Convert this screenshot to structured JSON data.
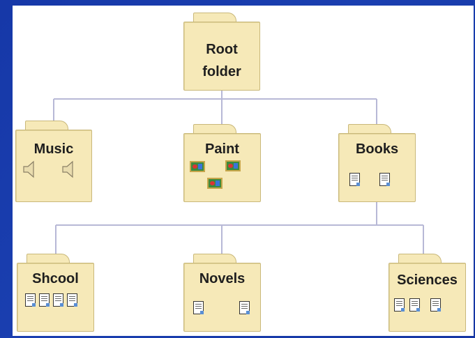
{
  "root": {
    "label_line1": "Root",
    "label_line2": "folder"
  },
  "level1": [
    {
      "label": "Music",
      "icon": "speaker-icon"
    },
    {
      "label": "Paint",
      "icon": "picture-icon"
    },
    {
      "label": "Books",
      "icon": "document-icon"
    }
  ],
  "level2": [
    {
      "label": "Shcool",
      "icon": "document-icon"
    },
    {
      "label": "Novels",
      "icon": "document-icon"
    },
    {
      "label": "Sciences",
      "icon": "document-icon"
    }
  ],
  "colors": {
    "background": "#1a3fb0",
    "folder_fill": "#f6e9b8",
    "folder_border": "#c9b87a",
    "connector": "#b7b8d6"
  }
}
